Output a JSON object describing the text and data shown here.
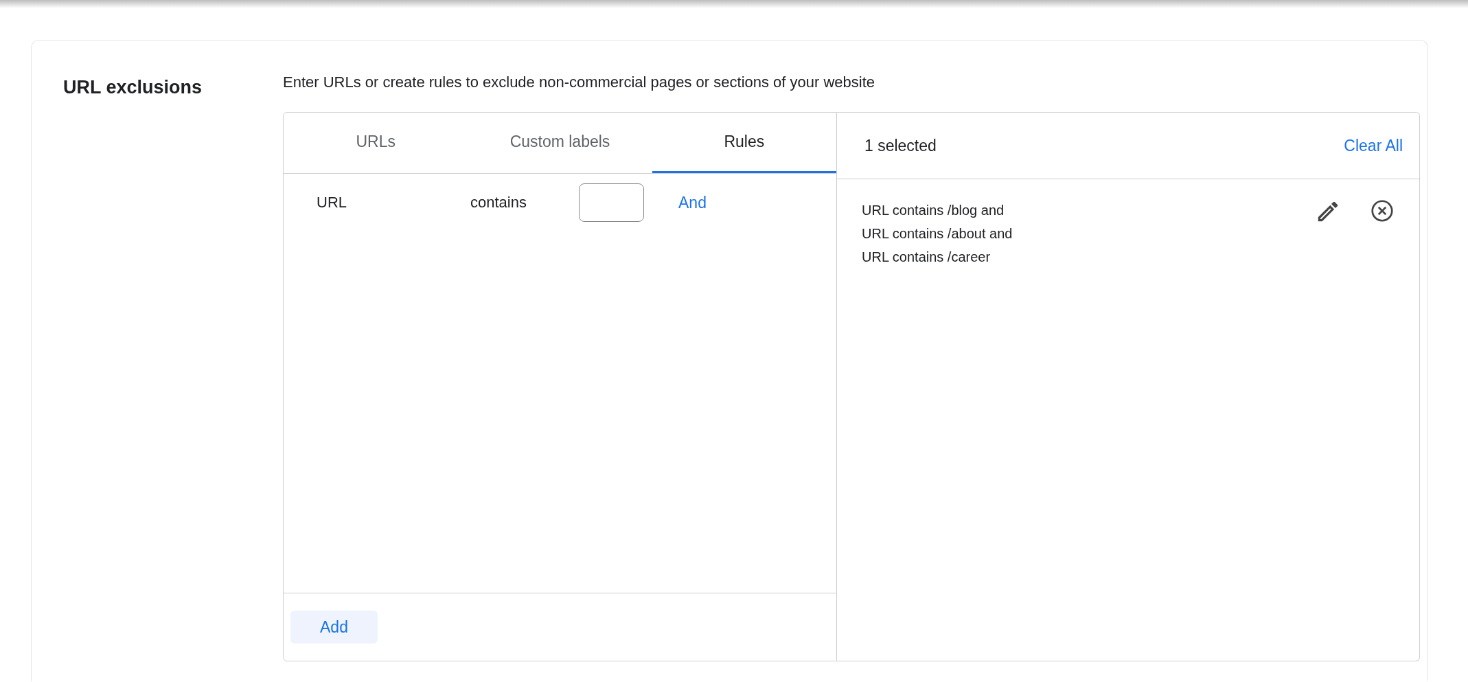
{
  "section": {
    "title": "URL exclusions",
    "description": "Enter URLs or create rules to exclude non-commercial pages or sections of your website"
  },
  "tabs": [
    {
      "label": "URLs",
      "selected": false
    },
    {
      "label": "Custom labels",
      "selected": false
    },
    {
      "label": "Rules",
      "selected": true
    }
  ],
  "rule": {
    "field": "URL",
    "operator": "contains",
    "connector": "And"
  },
  "add_button": "Add",
  "selection": {
    "count_label": "1 selected",
    "clear_button": "Clear All",
    "items": [
      {
        "lines": [
          "URL contains /blog and",
          "URL contains /about and",
          "URL contains /career"
        ]
      }
    ]
  }
}
